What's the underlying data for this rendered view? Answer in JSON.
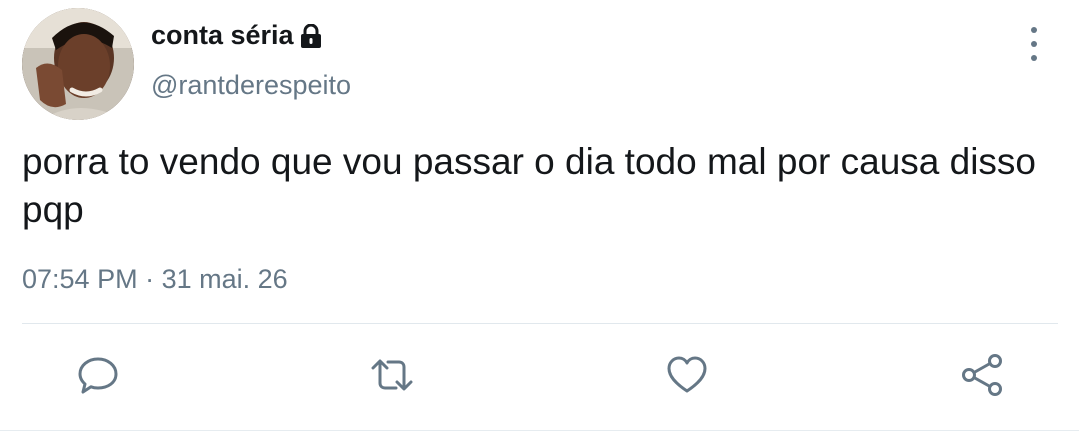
{
  "tweet": {
    "display_name": "conta séria",
    "handle": "@rantderespeito",
    "text": "porra to vendo que vou passar o dia todo mal por causa disso pqp",
    "time": "07:54 PM",
    "separator": " · ",
    "date": "31 mai. 26",
    "locked": true
  },
  "icons": {
    "lock": "lock-icon",
    "more": "more-vertical-icon",
    "reply": "reply-icon",
    "retweet": "retweet-icon",
    "like": "heart-icon",
    "share": "share-icon"
  },
  "colors": {
    "text": "#14171a",
    "secondary": "#657786",
    "icon": "#657786",
    "divider": "#e1e8ed"
  }
}
